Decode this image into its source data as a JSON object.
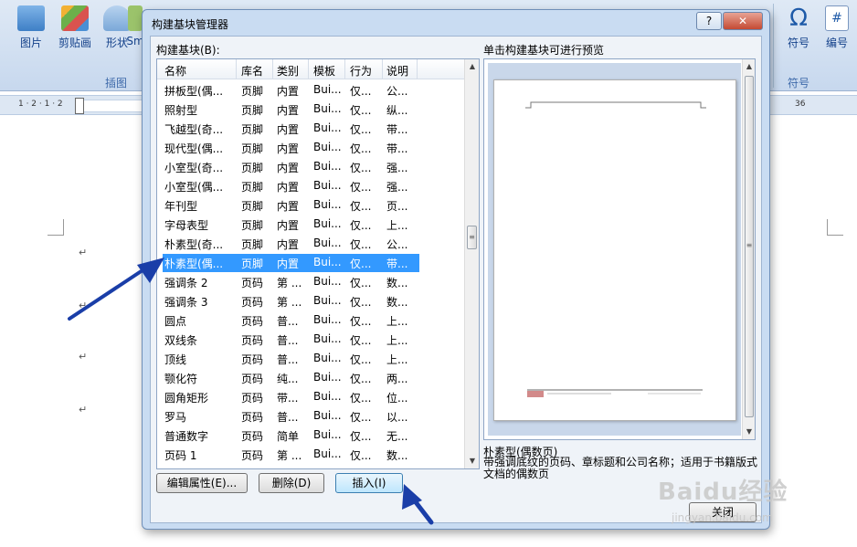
{
  "ribbon": {
    "buttons": [
      {
        "label": "图片",
        "icon": "picture-icon"
      },
      {
        "label": "剪贴画",
        "icon": "clipart-icon"
      },
      {
        "label": "形状",
        "icon": "shapes-icon"
      },
      {
        "label": "Sm",
        "icon": "smartart-icon"
      },
      {
        "label": "符号",
        "icon": "omega-icon"
      },
      {
        "label": "编号",
        "icon": "number-icon"
      }
    ],
    "group_insert": "插图",
    "group_symbol": "符号",
    "ruler_left": "1 · 2 · 1 · 2",
    "ruler_right": "36"
  },
  "dialog": {
    "title": "构建基块管理器",
    "help_label": "?",
    "close_label": "✕",
    "list_label": "构建基块(B):",
    "preview_label": "单击构建基块可进行预览",
    "columns": [
      "名称",
      "库名",
      "类别",
      "模板",
      "行为",
      "说明"
    ],
    "rows": [
      {
        "name": "拼板型(偶...",
        "gallery": "页脚",
        "category": "内置",
        "template": "Bui...",
        "behavior": "仅...",
        "desc": "公..."
      },
      {
        "name": "照射型",
        "gallery": "页脚",
        "category": "内置",
        "template": "Bui...",
        "behavior": "仅...",
        "desc": "纵..."
      },
      {
        "name": "飞越型(奇...",
        "gallery": "页脚",
        "category": "内置",
        "template": "Bui...",
        "behavior": "仅...",
        "desc": "带..."
      },
      {
        "name": "现代型(偶...",
        "gallery": "页脚",
        "category": "内置",
        "template": "Bui...",
        "behavior": "仅...",
        "desc": "带..."
      },
      {
        "name": "小室型(奇...",
        "gallery": "页脚",
        "category": "内置",
        "template": "Bui...",
        "behavior": "仅...",
        "desc": "强..."
      },
      {
        "name": "小室型(偶...",
        "gallery": "页脚",
        "category": "内置",
        "template": "Bui...",
        "behavior": "仅...",
        "desc": "强..."
      },
      {
        "name": "年刊型",
        "gallery": "页脚",
        "category": "内置",
        "template": "Bui...",
        "behavior": "仅...",
        "desc": "页..."
      },
      {
        "name": "字母表型",
        "gallery": "页脚",
        "category": "内置",
        "template": "Bui...",
        "behavior": "仅...",
        "desc": "上..."
      },
      {
        "name": "朴素型(奇...",
        "gallery": "页脚",
        "category": "内置",
        "template": "Bui...",
        "behavior": "仅...",
        "desc": "公..."
      },
      {
        "name": "朴素型(偶...",
        "gallery": "页脚",
        "category": "内置",
        "template": "Bui...",
        "behavior": "仅...",
        "desc": "带...",
        "selected": true
      },
      {
        "name": "强调条 2",
        "gallery": "页码",
        "category": "第 ...",
        "template": "Bui...",
        "behavior": "仅...",
        "desc": "数..."
      },
      {
        "name": "强调条 3",
        "gallery": "页码",
        "category": "第 ...",
        "template": "Bui...",
        "behavior": "仅...",
        "desc": "数..."
      },
      {
        "name": "圆点",
        "gallery": "页码",
        "category": "普...",
        "template": "Bui...",
        "behavior": "仅...",
        "desc": "上..."
      },
      {
        "name": "双线条",
        "gallery": "页码",
        "category": "普...",
        "template": "Bui...",
        "behavior": "仅...",
        "desc": "上..."
      },
      {
        "name": "顶线",
        "gallery": "页码",
        "category": "普...",
        "template": "Bui...",
        "behavior": "仅...",
        "desc": "上..."
      },
      {
        "name": "颚化符",
        "gallery": "页码",
        "category": "纯...",
        "template": "Bui...",
        "behavior": "仅...",
        "desc": "两..."
      },
      {
        "name": "圆角矩形",
        "gallery": "页码",
        "category": "带...",
        "template": "Bui...",
        "behavior": "仅...",
        "desc": "位..."
      },
      {
        "name": "罗马",
        "gallery": "页码",
        "category": "普...",
        "template": "Bui...",
        "behavior": "仅...",
        "desc": "以..."
      },
      {
        "name": "普通数字",
        "gallery": "页码",
        "category": "简单",
        "template": "Bui...",
        "behavior": "仅...",
        "desc": "无..."
      },
      {
        "name": "页码 1",
        "gallery": "页码",
        "category": "第 ...",
        "template": "Bui...",
        "behavior": "仅...",
        "desc": "数..."
      }
    ],
    "selected_name": "朴素型(偶数页)",
    "selected_desc": "带强调底纹的页码、章标题和公司名称；适用于书籍版式文档的偶数页",
    "buttons": {
      "edit": "编辑属性(E)...",
      "delete": "删除(D)",
      "insert": "插入(I)",
      "close": "关闭"
    }
  },
  "watermark": {
    "text": "Baidu经验",
    "url": "jingyan.baidu.com"
  }
}
